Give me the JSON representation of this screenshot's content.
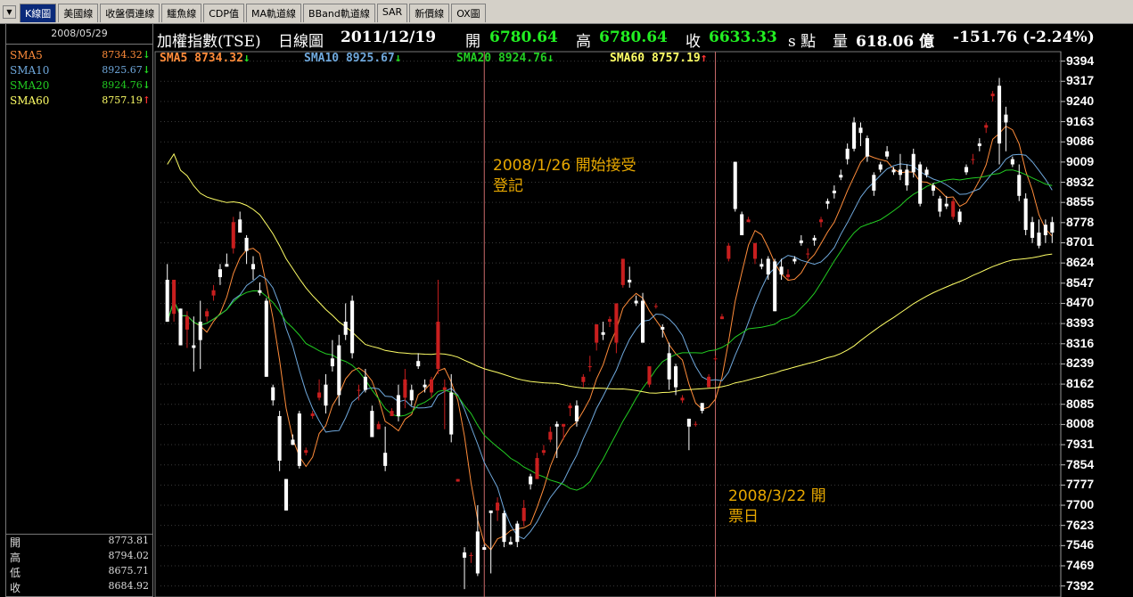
{
  "tabs": [
    {
      "label": "K線圖",
      "active": true
    },
    {
      "label": "美國線",
      "active": false
    },
    {
      "label": "收盤價連線",
      "active": false
    },
    {
      "label": "鱷魚線",
      "active": false
    },
    {
      "label": "CDP值",
      "active": false
    },
    {
      "label": "MA軌道線",
      "active": false
    },
    {
      "label": "BBand軌道線",
      "active": false
    },
    {
      "label": "SAR",
      "active": false
    },
    {
      "label": "新價線",
      "active": false
    },
    {
      "label": "OX圖",
      "active": false
    }
  ],
  "menu_icon": "chevron-down-icon",
  "side": {
    "date": "2008/05/29",
    "sma": [
      {
        "label": "SMA5",
        "value": "8734.32",
        "color": "#ff8c3a",
        "arrow": "↓",
        "arrow_color": "#22dd22"
      },
      {
        "label": "SMA10",
        "value": "8925.67",
        "color": "#6fa8dc",
        "arrow": "↓",
        "arrow_color": "#22dd22"
      },
      {
        "label": "SMA20",
        "value": "8924.76",
        "color": "#22cc22",
        "arrow": "↓",
        "arrow_color": "#22dd22"
      },
      {
        "label": "SMA60",
        "value": "8757.19",
        "color": "#ffff66",
        "arrow": "↑",
        "arrow_color": "#ff3333"
      }
    ],
    "ohlc": [
      {
        "label": "開",
        "value": "8773.81"
      },
      {
        "label": "高",
        "value": "8794.02"
      },
      {
        "label": "低",
        "value": "8675.71"
      },
      {
        "label": "收",
        "value": "8684.92"
      }
    ]
  },
  "header": {
    "title": "加權指數(TSE)",
    "period": "日線圖",
    "date": "2011/12/19",
    "open_label": "開",
    "open": "6780.64",
    "high_label": "高",
    "high": "6780.64",
    "close_label": "收",
    "close": "6633.33",
    "unit": "s 點",
    "volume_label": "量",
    "volume": "618.06 億",
    "change": "-151.76 (-2.24%)"
  },
  "legend": [
    {
      "text": "SMA5 8734.32",
      "arrow": "↓",
      "color": "#ff8c3a",
      "arrow_color": "#22dd22"
    },
    {
      "text": "SMA10 8925.67",
      "arrow": "↓",
      "color": "#6fa8dc",
      "arrow_color": "#22dd22"
    },
    {
      "text": "SMA20 8924.76",
      "arrow": "↓",
      "color": "#22cc22",
      "arrow_color": "#22dd22"
    },
    {
      "text": "SMA60 8757.19",
      "arrow": "↑",
      "color": "#ffff66",
      "arrow_color": "#ff3333"
    }
  ],
  "annotations": [
    {
      "lines": [
        "2008/1/26 開始接受",
        "登記"
      ]
    },
    {
      "lines": [
        "2008/3/22 開",
        "票日"
      ]
    }
  ],
  "colors": {
    "up": "#c81e1e",
    "down": "#ffffff",
    "grid": "#3a3a3a",
    "event_line": "#c86a6a"
  },
  "chart_data": {
    "type": "candlestick",
    "y_ticks": [
      9394,
      9317,
      9240,
      9163,
      9086,
      9009,
      8932,
      8855,
      8778,
      8701,
      8624,
      8547,
      8470,
      8393,
      8316,
      8239,
      8162,
      8085,
      8008,
      7931,
      7854,
      7777,
      7700,
      7623,
      7546,
      7469,
      7392
    ],
    "ylim": [
      7350,
      9430
    ],
    "candles": [
      [
        8560,
        8620,
        8420,
        8400
      ],
      [
        8430,
        8560,
        8400,
        8560
      ],
      [
        8450,
        8440,
        8320,
        8310
      ],
      [
        8370,
        8440,
        8300,
        8420
      ],
      [
        8310,
        8420,
        8210,
        8300
      ],
      [
        8400,
        8480,
        8220,
        8330
      ],
      [
        8420,
        8450,
        8400,
        8440
      ],
      [
        8500,
        8540,
        8480,
        8520
      ],
      [
        8600,
        8620,
        8540,
        8570
      ],
      [
        8620,
        8660,
        8610,
        8610
      ],
      [
        8680,
        8800,
        8660,
        8780
      ],
      [
        8790,
        8820,
        8740,
        8740
      ],
      [
        8720,
        8730,
        8620,
        8670
      ],
      [
        8620,
        8650,
        8560,
        8600
      ],
      [
        8520,
        8550,
        8500,
        8510
      ],
      [
        8480,
        8490,
        8190,
        8190
      ],
      [
        8150,
        8160,
        8080,
        8100
      ],
      [
        8040,
        8060,
        7830,
        7870
      ],
      [
        7800,
        7800,
        7700,
        7680
      ],
      [
        7950,
        7970,
        7930,
        7930
      ],
      [
        8050,
        8060,
        7840,
        7850
      ],
      [
        7900,
        7920,
        7890,
        7910
      ],
      [
        8040,
        8060,
        8030,
        8050
      ],
      [
        8110,
        8180,
        8100,
        8130
      ],
      [
        8160,
        8200,
        8050,
        8080
      ],
      [
        8260,
        8330,
        8210,
        8230
      ],
      [
        8310,
        8350,
        8080,
        8120
      ],
      [
        8400,
        8470,
        8330,
        8350
      ],
      [
        8480,
        8500,
        8260,
        8280
      ],
      [
        8140,
        8160,
        8100,
        8140
      ],
      [
        8190,
        8220,
        8130,
        8140
      ],
      [
        8060,
        8080,
        7960,
        7960
      ],
      [
        7990,
        8020,
        7990,
        8010
      ],
      [
        7900,
        8000,
        7830,
        7850
      ],
      [
        8040,
        8070,
        8040,
        8060
      ],
      [
        8120,
        8160,
        8020,
        8040
      ],
      [
        8110,
        8220,
        8070,
        8180
      ],
      [
        8140,
        8160,
        8080,
        8100
      ],
      [
        8250,
        8280,
        8220,
        8230
      ],
      [
        8160,
        8180,
        8130,
        8150
      ],
      [
        8130,
        8190,
        8110,
        8180
      ],
      [
        8220,
        8560,
        8200,
        8400
      ],
      [
        8140,
        8180,
        7990,
        8150
      ],
      [
        8130,
        8200,
        7940,
        7970
      ],
      [
        7790,
        7800,
        7790,
        7800
      ],
      [
        7520,
        7540,
        7380,
        7500
      ],
      [
        7510,
        7520,
        7480,
        7510
      ],
      [
        7600,
        7700,
        7430,
        7440
      ],
      [
        7540,
        7550,
        7530,
        7530
      ],
      [
        7680,
        7680,
        7440,
        7670
      ],
      [
        7680,
        7730,
        7640,
        7710
      ],
      [
        7670,
        7680,
        7540,
        7560
      ],
      [
        7560,
        7580,
        7550,
        7550
      ],
      [
        7630,
        7640,
        7540,
        7560
      ],
      [
        7640,
        7720,
        7620,
        7690
      ],
      [
        7810,
        7820,
        7760,
        7780
      ],
      [
        7800,
        7900,
        7800,
        7880
      ],
      [
        7900,
        7930,
        7890,
        7910
      ],
      [
        7950,
        8000,
        7940,
        7980
      ],
      [
        8010,
        8020,
        7880,
        8000
      ],
      [
        8000,
        8000,
        7950,
        8010
      ],
      [
        8070,
        8090,
        8040,
        8080
      ],
      [
        8080,
        8100,
        8000,
        8020
      ],
      [
        8170,
        8200,
        8150,
        8190
      ],
      [
        8230,
        8270,
        8210,
        8230
      ],
      [
        8320,
        8370,
        8290,
        8390
      ],
      [
        8360,
        8400,
        8330,
        8350
      ],
      [
        8400,
        8420,
        8380,
        8410
      ],
      [
        8320,
        8470,
        8280,
        8470
      ],
      [
        8540,
        8640,
        8530,
        8640
      ],
      [
        8560,
        8610,
        8530,
        8550
      ],
      [
        8480,
        8500,
        8460,
        8470
      ],
      [
        8480,
        8510,
        8380,
        8320
      ],
      [
        8160,
        8170,
        8150,
        8230
      ],
      [
        8460,
        8470,
        8450,
        8460
      ],
      [
        8380,
        8390,
        8340,
        8370
      ],
      [
        8280,
        8320,
        8140,
        8180
      ],
      [
        8230,
        8240,
        8120,
        8150
      ],
      [
        8100,
        8120,
        8090,
        8110
      ],
      [
        8030,
        8030,
        7910,
        8000
      ],
      [
        8010,
        8020,
        8000,
        8010
      ],
      [
        8090,
        8090,
        8050,
        8060
      ],
      [
        8150,
        8200,
        8150,
        8190
      ],
      [
        8260,
        8270,
        8250,
        8260
      ],
      [
        8410,
        8430,
        8410,
        8420
      ],
      [
        8640,
        8700,
        8630,
        8690
      ],
      [
        9010,
        9010,
        8820,
        8830
      ],
      [
        8810,
        8820,
        8730,
        8730
      ],
      [
        8780,
        8800,
        8780,
        8790
      ],
      [
        8640,
        8700,
        8620,
        8700
      ],
      [
        8620,
        8640,
        8600,
        8610
      ],
      [
        8640,
        8650,
        8560,
        8580
      ],
      [
        8630,
        8640,
        8500,
        8440
      ],
      [
        8610,
        8640,
        8560,
        8580
      ],
      [
        8570,
        8600,
        8560,
        8580
      ],
      [
        8640,
        8650,
        8620,
        8630
      ],
      [
        8710,
        8730,
        8690,
        8700
      ],
      [
        8660,
        8680,
        8640,
        8660
      ],
      [
        8720,
        8730,
        8690,
        8710
      ],
      [
        8780,
        8800,
        8760,
        8790
      ],
      [
        8860,
        8870,
        8830,
        8850
      ],
      [
        8900,
        8920,
        8870,
        8890
      ],
      [
        8960,
        8980,
        8940,
        8950
      ],
      [
        9060,
        9080,
        9000,
        9020
      ],
      [
        9160,
        9180,
        9050,
        9060
      ],
      [
        9140,
        9160,
        9070,
        9120
      ],
      [
        9100,
        9110,
        9010,
        9030
      ],
      [
        8960,
        8970,
        8880,
        8900
      ],
      [
        9000,
        9010,
        8970,
        8980
      ],
      [
        9050,
        9070,
        9020,
        9030
      ],
      [
        8980,
        8990,
        8960,
        8970
      ],
      [
        8980,
        9040,
        8940,
        8960
      ],
      [
        8980,
        9000,
        8900,
        8920
      ],
      [
        9040,
        9060,
        8950,
        8970
      ],
      [
        9000,
        9010,
        8840,
        8850
      ],
      [
        8980,
        8990,
        8950,
        8960
      ],
      [
        8920,
        8930,
        8880,
        8900
      ],
      [
        8870,
        8880,
        8800,
        8820
      ],
      [
        8850,
        8880,
        8830,
        8840
      ],
      [
        8800,
        8870,
        8790,
        8860
      ],
      [
        8820,
        8830,
        8770,
        8780
      ],
      [
        8990,
        9000,
        8960,
        8970
      ],
      [
        9020,
        9040,
        9000,
        9020
      ],
      [
        9080,
        9100,
        9050,
        9070
      ],
      [
        9140,
        9160,
        9120,
        9150
      ],
      [
        9260,
        9280,
        9240,
        9270
      ],
      [
        9300,
        9330,
        9000,
        9080
      ],
      [
        9190,
        9220,
        9050,
        9160
      ],
      [
        9020,
        9030,
        8990,
        9000
      ],
      [
        8960,
        9000,
        8860,
        8880
      ],
      [
        8870,
        8890,
        8730,
        8750
      ],
      [
        8780,
        8800,
        8700,
        8720
      ],
      [
        8740,
        8790,
        8680,
        8690
      ],
      [
        8770,
        8790,
        8700,
        8730
      ],
      [
        8780,
        8800,
        8700,
        8740
      ]
    ],
    "series": [
      {
        "name": "SMA5",
        "color": "#ff8c3a"
      },
      {
        "name": "SMA10",
        "color": "#6fa8dc"
      },
      {
        "name": "SMA20",
        "color": "#22cc22"
      },
      {
        "name": "SMA60",
        "color": "#ffff66"
      }
    ],
    "events": [
      {
        "label": "2008/1/26"
      },
      {
        "label": "2008/3/22"
      }
    ]
  }
}
